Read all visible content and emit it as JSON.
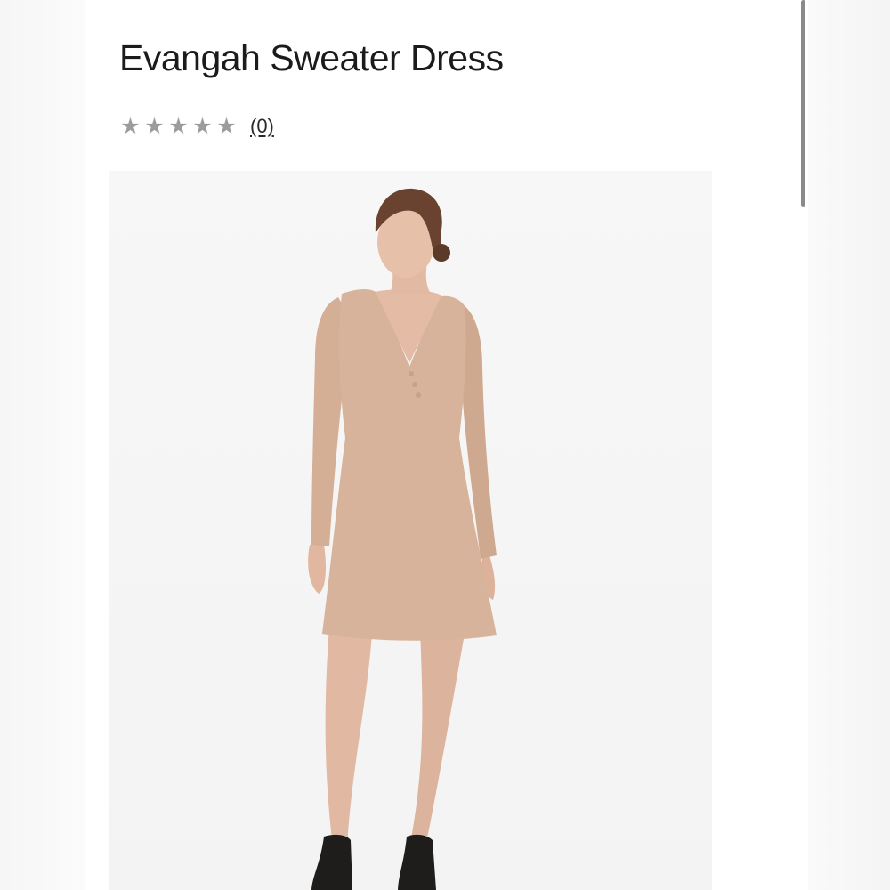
{
  "product": {
    "title": "Evangah Sweater Dress",
    "rating": {
      "stars_filled": 0,
      "stars_total": 5,
      "review_count_label": "(0)"
    },
    "image": {
      "subject": "model-wearing-sweater-dress",
      "dress_color": "#d7b39b",
      "boot_color": "#1f1c1c"
    }
  },
  "colors": {
    "title_text": "#1b1b1b",
    "star_empty": "#9c9c9c",
    "scrollbar_thumb": "#8a8a8a"
  },
  "icons": {
    "star": "star-icon"
  }
}
